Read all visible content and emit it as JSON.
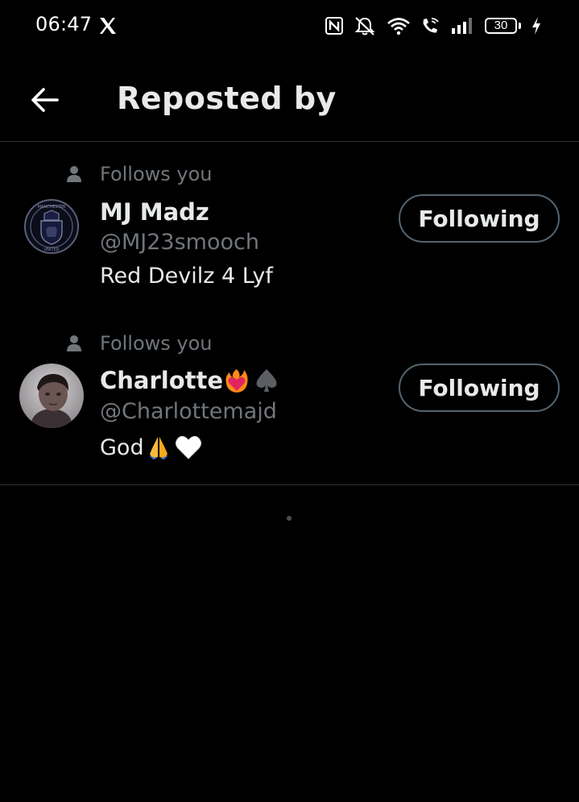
{
  "status_bar": {
    "time": "06:47",
    "battery": "30",
    "icons": [
      "x-logo-icon",
      "nfc-icon",
      "mute-icon",
      "wifi-icon",
      "wifi-call-icon",
      "signal-icon",
      "battery-icon",
      "charging-icon"
    ]
  },
  "header": {
    "title": "Reposted by",
    "back_icon": "arrow-left-icon"
  },
  "users": [
    {
      "follows_label": "Follows you",
      "name": "MJ Madz",
      "handle": "@MJ23smooch",
      "bio": "Red Devilz 4 Lyf",
      "button_label": "Following",
      "avatar": "manchester-united-crest"
    },
    {
      "follows_label": "Follows you",
      "name": "Charlotte",
      "handle": "@Charlottemajd",
      "bio": "God",
      "button_label": "Following",
      "avatar": "profile-photo"
    }
  ],
  "colors": {
    "background": "#000000",
    "primary_text": "#e7e9ea",
    "secondary_text": "#71767b",
    "border": "#2f3336",
    "button_border": "#536471"
  }
}
